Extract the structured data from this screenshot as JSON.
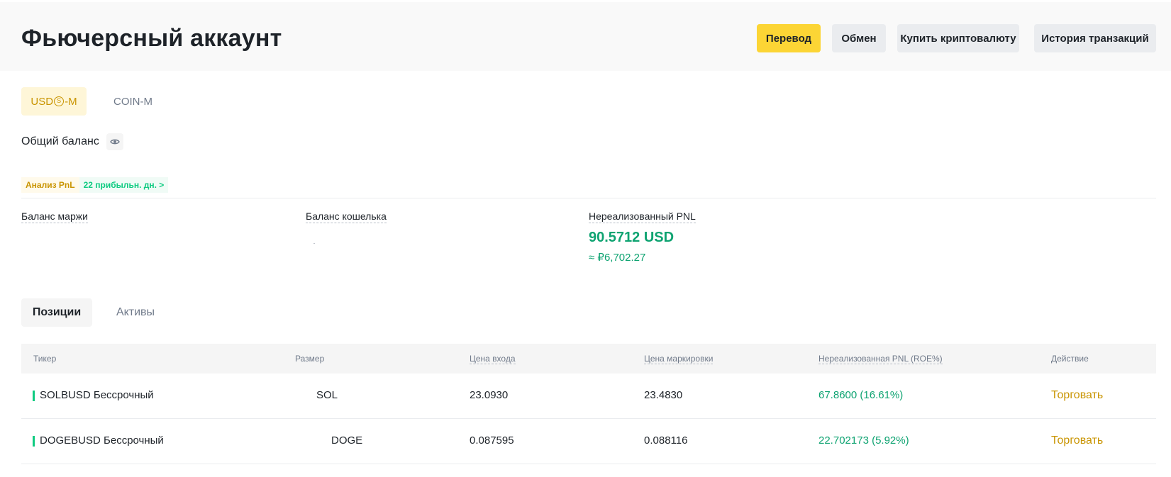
{
  "header": {
    "title": "Фьючерсный аккаунт",
    "buttons": {
      "transfer": "Перевод",
      "exchange": "Обмен",
      "buy_crypto": "Купить криптовалюту",
      "history": "История транзакций"
    }
  },
  "segments": {
    "usds_prefix": "USD",
    "usds_coin": "S",
    "usds_suffix": "-M",
    "coin": "COIN-M",
    "active": "USDⓈ-M"
  },
  "balance": {
    "label": "Общий баланс",
    "eye_icon": "eye-icon"
  },
  "pnl_analysis": {
    "label": "Анализ PnL",
    "days": "22 прибыльн. дн. >"
  },
  "metrics": {
    "margin_balance_label": "Баланс маржи",
    "wallet_balance_label": "Баланс кошелька",
    "unrealized_pnl_label": "Нереализованный PNL",
    "unrealized_pnl_value": "90.5712 USD",
    "unrealized_pnl_approx": "≈ ₽6,702.27"
  },
  "tabs": {
    "positions": "Позиции",
    "assets": "Активы",
    "active": "Позиции"
  },
  "table": {
    "headers": {
      "ticker": "Тикер",
      "size": "Размер",
      "entry_price": "Цена входа",
      "mark_price": "Цена маркировки",
      "unrealized_pnl": "Нереализованная PNL (ROE%)",
      "action": "Действие"
    },
    "rows": [
      {
        "ticker": "SOLBUSD Бессрочный",
        "size": "SOL",
        "entry_price": "23.0930",
        "mark_price": "23.4830",
        "pnl": "67.8600 (16.61%)",
        "action": "Торговать"
      },
      {
        "ticker": "DOGEBUSD Бессрочный",
        "size": "DOGE",
        "entry_price": "0.087595",
        "mark_price": "0.088116",
        "pnl": "22.702173 (5.92%)",
        "action": "Торговать"
      }
    ]
  },
  "colors": {
    "accent_yellow": "#fcd535",
    "gold_text": "#c99400",
    "positive_green": "#0ea371",
    "long_indicator": "#0ecb81"
  }
}
